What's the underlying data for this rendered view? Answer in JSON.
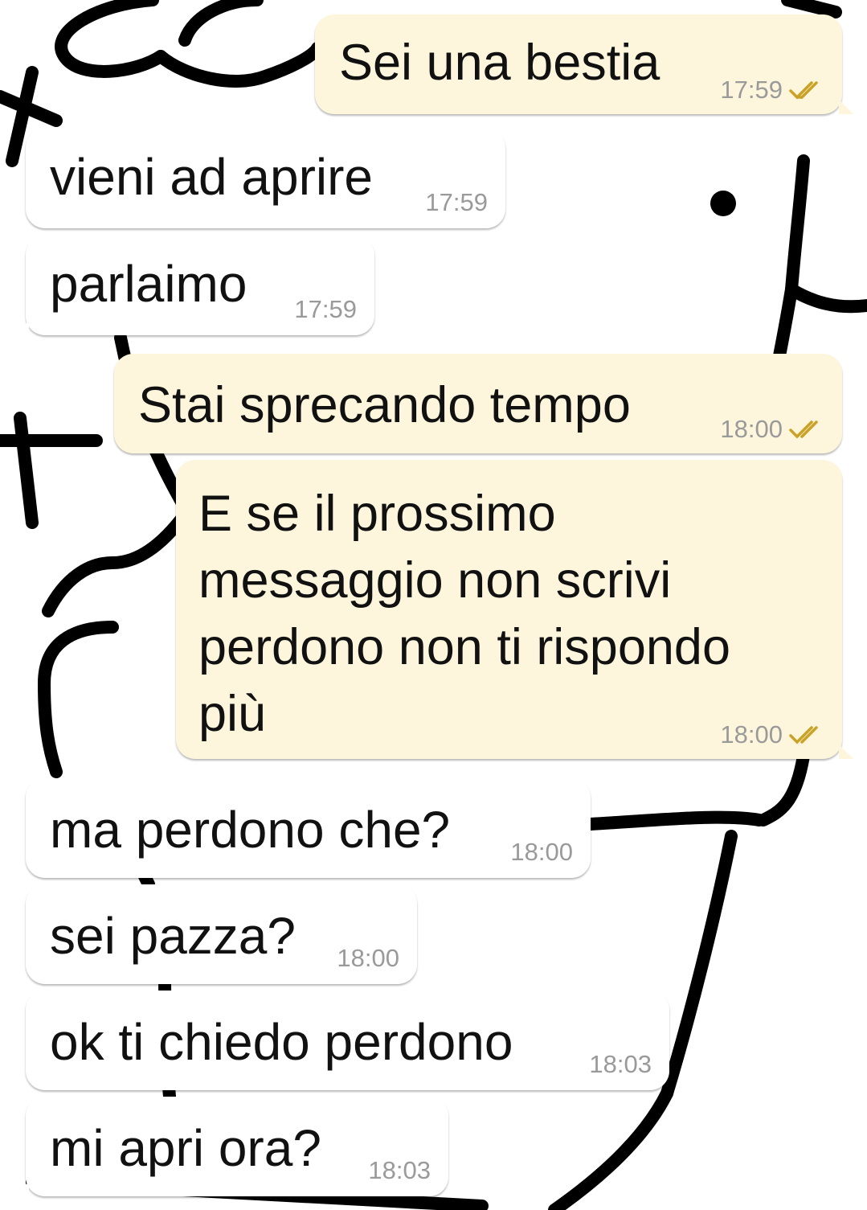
{
  "colors": {
    "incoming_bubble": "#ffffff",
    "outgoing_bubble": "#fdf6dc",
    "timestamp": "#9a9a9a",
    "read_check": "#c9a227",
    "wallpaper_lines": "#000000"
  },
  "wallpaper": {
    "description_icon": "cartoon-doodle-wallpaper"
  },
  "messages": [
    {
      "direction": "out",
      "text": "Sei una bestia",
      "time": "17:59",
      "status_icon": "double-check-icon"
    },
    {
      "direction": "in",
      "text": "vieni ad aprire",
      "time": "17:59"
    },
    {
      "direction": "in",
      "text": "parlaimo",
      "time": "17:59"
    },
    {
      "direction": "out",
      "text": "Stai sprecando tempo",
      "time": "18:00",
      "status_icon": "double-check-icon"
    },
    {
      "direction": "out",
      "text": "E se il prossimo\nmessaggio non scrivi\nperdono non ti rispondo\npiù",
      "time": "18:00",
      "status_icon": "double-check-icon"
    },
    {
      "direction": "in",
      "text": "ma perdono che?",
      "time": "18:00"
    },
    {
      "direction": "in",
      "text": "sei pazza?",
      "time": "18:00"
    },
    {
      "direction": "in",
      "text": "ok ti chiedo perdono",
      "time": "18:03"
    },
    {
      "direction": "in",
      "text": "mi apri ora?",
      "time": "18:03"
    }
  ]
}
